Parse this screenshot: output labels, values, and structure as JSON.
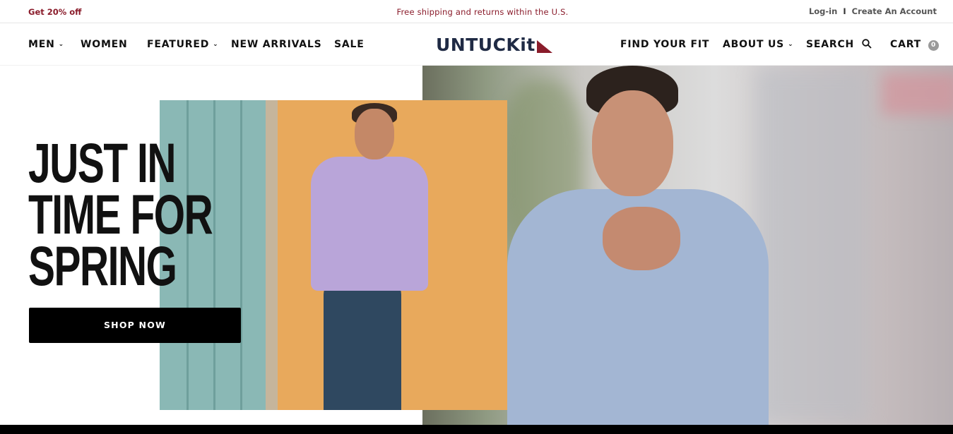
{
  "promo": {
    "left": "Get 20% off",
    "center": "Free shipping and returns within the U.S.",
    "login": "Log-in",
    "separator": "I",
    "create_account": "Create An Account"
  },
  "nav": {
    "left": [
      {
        "label": "MEN",
        "dropdown": true
      },
      {
        "label": "WOMEN",
        "dropdown": false
      },
      {
        "label": "FEATURED",
        "dropdown": true
      },
      {
        "label": "NEW ARRIVALS",
        "dropdown": false
      },
      {
        "label": "SALE",
        "dropdown": false
      }
    ],
    "logo": "UNTUCKit",
    "right": [
      {
        "label": "FIND YOUR FIT",
        "dropdown": false
      },
      {
        "label": "ABOUT US",
        "dropdown": true
      },
      {
        "label": "SEARCH",
        "icon": "search-icon"
      },
      {
        "label": "CART",
        "badge": "0"
      }
    ]
  },
  "hero": {
    "headline": [
      "JUST IN",
      "TIME FOR",
      "SPRING"
    ],
    "cta": "SHOP NOW"
  },
  "colors": {
    "promo_text": "#8a1c2b",
    "logo_navy": "#1f2a44",
    "logo_accent": "#8a1c2b",
    "button_bg": "#000000"
  }
}
